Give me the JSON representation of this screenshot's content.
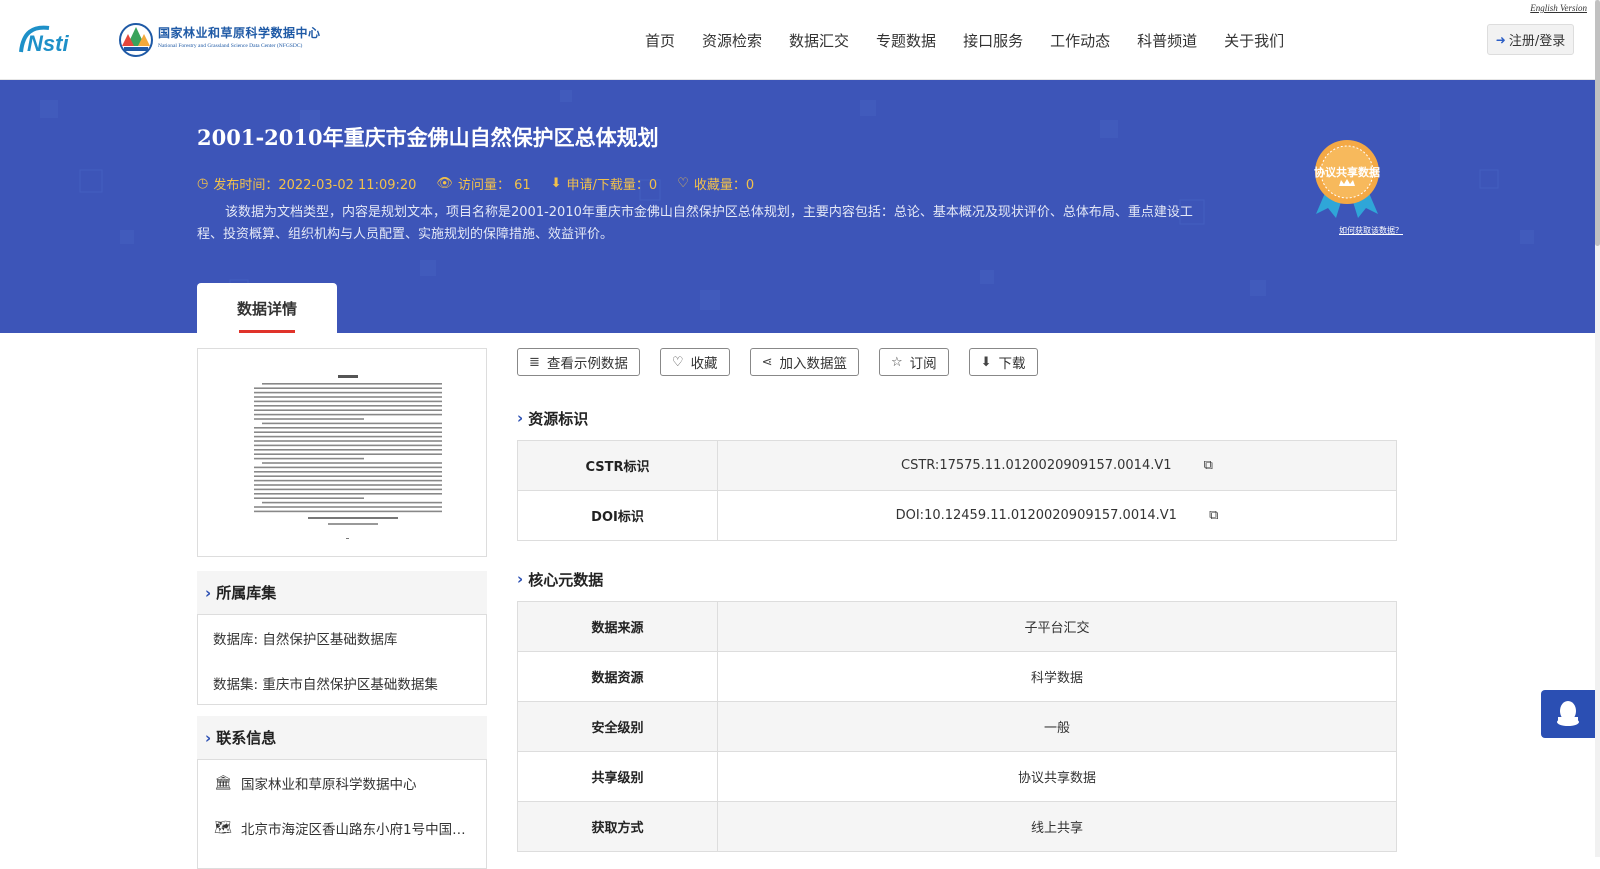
{
  "header": {
    "logo_nsti": "Nsti",
    "logo_org_cn": "国家林业和草原科学数据中心",
    "logo_org_en": "National Forestry and Grassland Science Data Center (NFGSDC)",
    "english_link": "English Version",
    "nav": [
      "首页",
      "资源检索",
      "数据汇交",
      "专题数据",
      "接口服务",
      "工作动态",
      "科普频道",
      "关于我们"
    ],
    "login_label": "注册/登录"
  },
  "banner": {
    "title": "2001-2010年重庆市金佛山自然保护区总体规划",
    "publish_time": "发布时间：2022-03-02 11:09:20",
    "visits": "访问量： 61",
    "downloads": "申请/下载量：0",
    "favorites": "收藏量：0",
    "description": "该数据为文档类型，内容是规划文本，项目名称是2001-2010年重庆市金佛山自然保护区总体规划，主要内容包括：总论、基本概况及现状评价、总体布局、重点建设工程、投资概算、组织机构与人员配置、实施规划的保障措施、效益评价。",
    "badge_text": "协议共享数据",
    "badge_link": "如何获取该数据？",
    "tab_label": "数据详情"
  },
  "left": {
    "collection_heading": "所属库集",
    "collection_items": [
      "数据库: 自然保护区基础数据库",
      "数据集: 重庆市自然保护区基础数据集"
    ],
    "contact_heading": "联系信息",
    "contact_items": [
      "国家林业和草原科学数据中心",
      "北京市海淀区香山路东小府1号中国…"
    ]
  },
  "actions": [
    "查看示例数据",
    "收藏",
    "加入数据篮",
    "订阅",
    "下载"
  ],
  "resource_id": {
    "heading": "资源标识",
    "rows": [
      {
        "key": "CSTR标识",
        "value": "CSTR:17575.11.0120020909157.0014.V1"
      },
      {
        "key": "DOI标识",
        "value": "DOI:10.12459.11.0120020909157.0014.V1"
      }
    ]
  },
  "core_meta": {
    "heading": "核心元数据",
    "rows": [
      {
        "key": "数据来源",
        "value": "子平台汇交"
      },
      {
        "key": "数据资源",
        "value": "科学数据"
      },
      {
        "key": "安全级别",
        "value": "一般"
      },
      {
        "key": "共享级别",
        "value": "协议共享数据"
      },
      {
        "key": "获取方式",
        "value": "线上共享"
      }
    ]
  },
  "colors": {
    "banner_bg": "#3d55b8",
    "meta_text": "#f2c14b",
    "accent_blue": "#2b4fb3",
    "tab_underline": "#e0332a"
  }
}
